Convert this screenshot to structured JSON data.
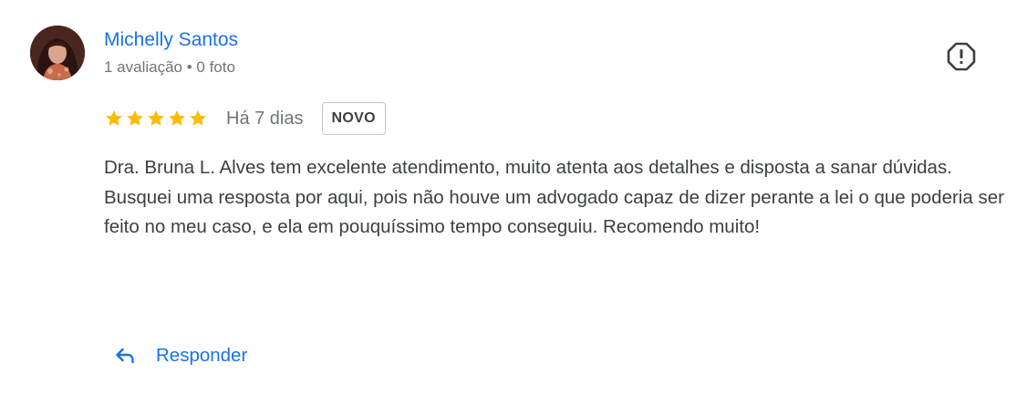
{
  "review": {
    "author": {
      "name": "Michelly Santos",
      "meta": "1 avaliação • 0 foto",
      "avatar_icon": "profile-photo"
    },
    "rating": {
      "stars": 5,
      "max_stars": 5,
      "star_color": "#fbbc04"
    },
    "date": "Há 7 dias",
    "badge": "NOVO",
    "text": {
      "paragraph_1": "Dra. Bruna L. Alves tem excelente atendimento, muito atenta aos detalhes e disposta a sanar dúvidas.",
      "paragraph_2": "Busquei uma resposta por aqui, pois não houve um advogado capaz de dizer perante a lei o que poderia ser feito no meu caso, e ela em pouquíssimo tempo conseguiu. Recomendo muito!"
    },
    "actions": {
      "reply_label": "Responder",
      "reply_icon": "reply-arrow-icon",
      "report_icon": "report-icon"
    }
  },
  "colors": {
    "link_blue": "#1a73e8",
    "secondary_text": "#70757a",
    "body_text": "#3c4043",
    "icon_dark": "#3c4043"
  }
}
